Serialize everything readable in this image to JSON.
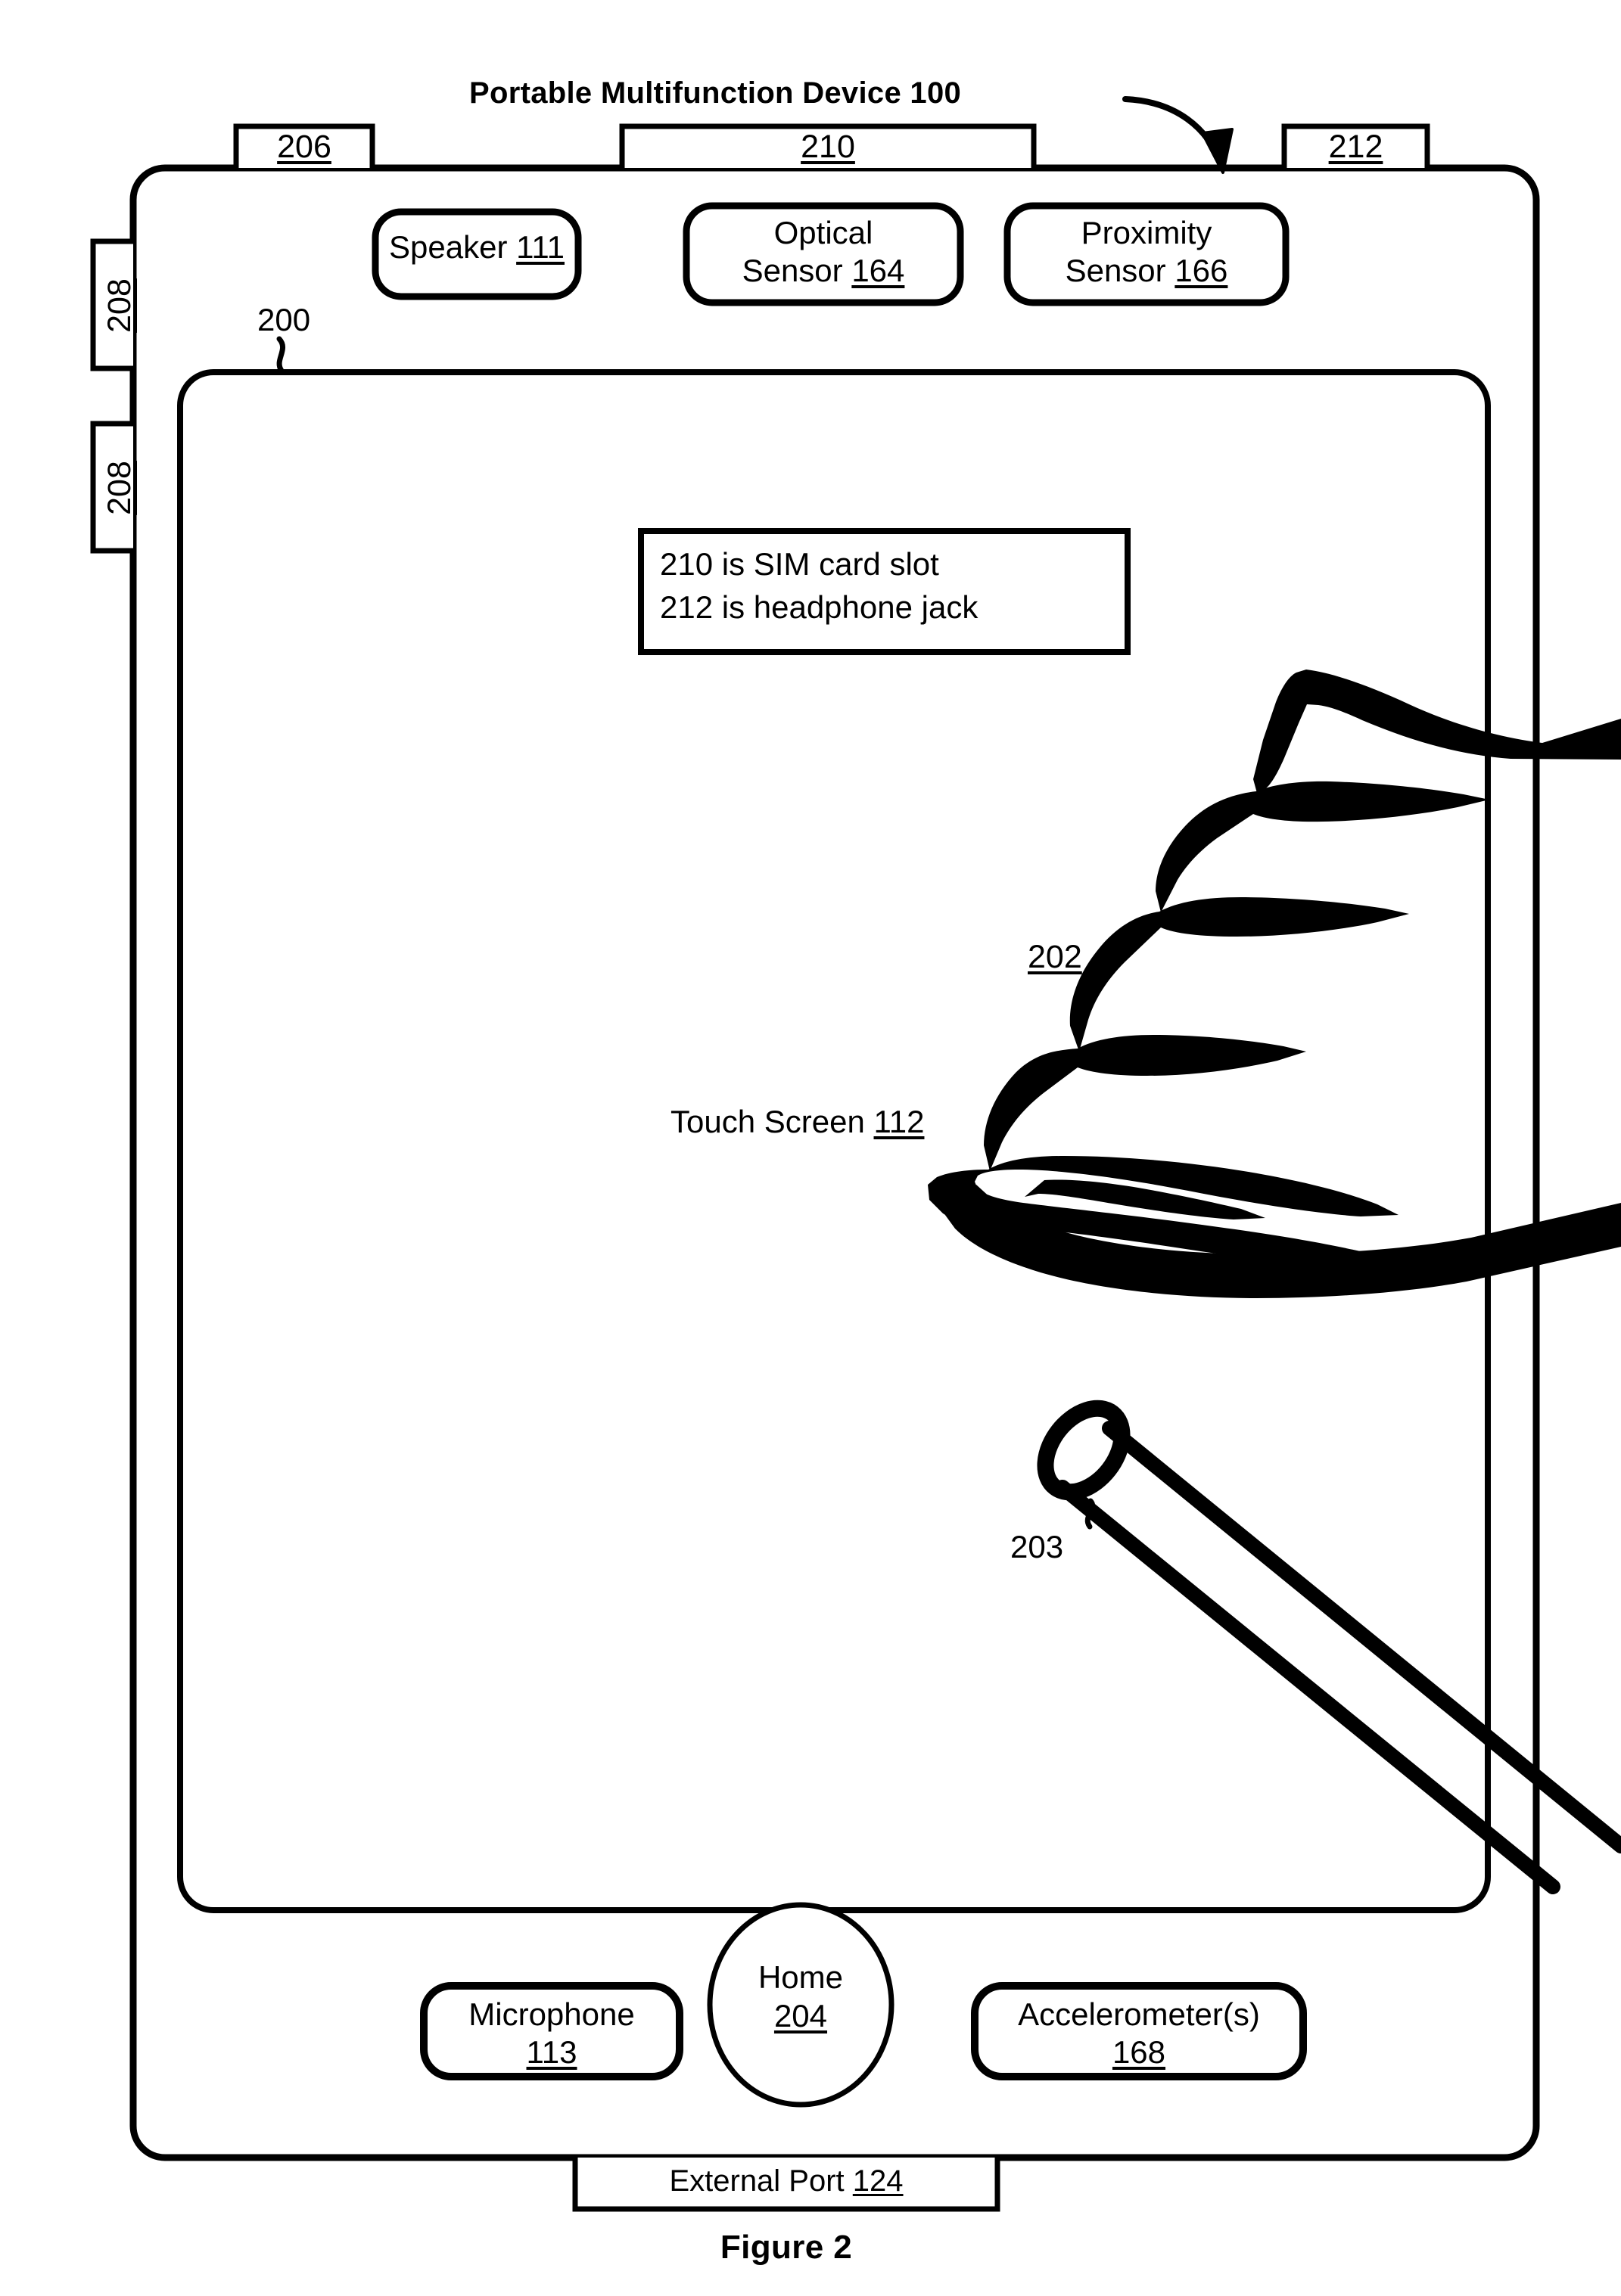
{
  "figure": {
    "title": "Portable Multifunction Device 100",
    "title_ref": "100",
    "caption": "Figure 2"
  },
  "device": {
    "top_labels": [
      {
        "name": "button-206",
        "ref": "206"
      },
      {
        "name": "sim-card-slot-210",
        "ref": "210"
      },
      {
        "name": "headphone-jack-212",
        "ref": "212"
      }
    ],
    "side_labels": [
      {
        "name": "volume-button-upper-208",
        "ref": "208"
      },
      {
        "name": "volume-button-lower-208",
        "ref": "208"
      }
    ],
    "sensor_row": [
      {
        "name": "speaker",
        "label": "Speaker ",
        "ref": "111",
        "lines": 1
      },
      {
        "name": "optical-sensor",
        "label": "Optical\nSensor ",
        "ref": "164",
        "lines": 2
      },
      {
        "name": "proximity-sensor",
        "label": "Proximity\nSensor ",
        "ref": "166",
        "lines": 2
      }
    ],
    "bottom_row": [
      {
        "name": "microphone",
        "label": "Microphone",
        "ref": "113"
      },
      {
        "name": "home-button",
        "label": "Home",
        "ref": "204"
      },
      {
        "name": "accelerometers",
        "label": "Accelerometer(s)",
        "ref": "168"
      }
    ],
    "external_port": {
      "label": "External Port ",
      "ref": "124"
    },
    "bezel_ref": "200",
    "touch_screen": {
      "label": "Touch Screen ",
      "ref": "112"
    },
    "finger_ref": "202",
    "stylus_ref": "203"
  },
  "annotation_box": {
    "line1": "210 is SIM card slot",
    "line2": "212 is headphone jack"
  },
  "colors": {
    "ink": "#000000",
    "paper": "#ffffff"
  }
}
